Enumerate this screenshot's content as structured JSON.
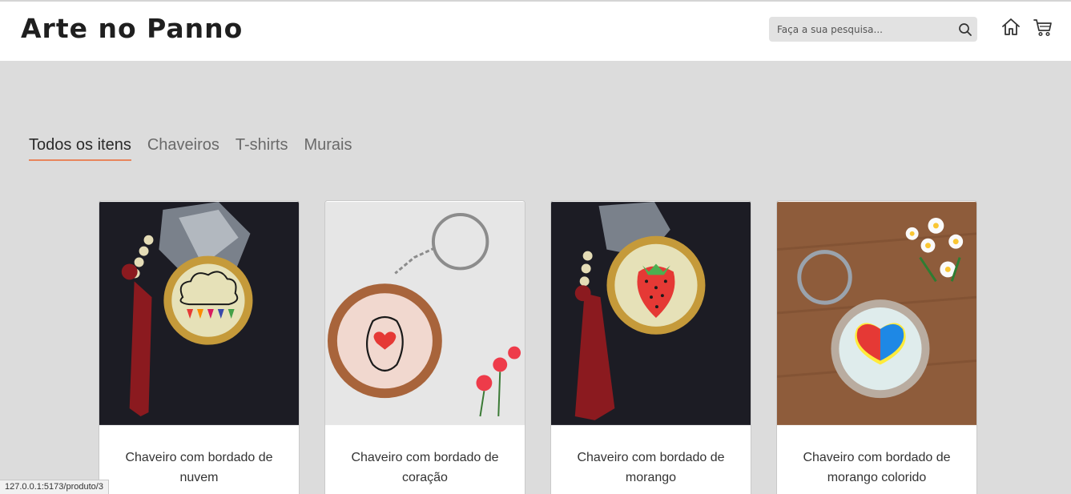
{
  "header": {
    "logo": "Arte no Panno",
    "search_placeholder": "Faça a sua pesquisa...",
    "icons": [
      "search-icon",
      "home-icon",
      "cart-icon"
    ]
  },
  "tabs": [
    {
      "label": "Todos os itens",
      "active": true
    },
    {
      "label": "Chaveiros",
      "active": false
    },
    {
      "label": "T-shirts",
      "active": false
    },
    {
      "label": "Murais",
      "active": false
    }
  ],
  "products": [
    {
      "title": "Chaveiro com bordado de nuvem"
    },
    {
      "title": "Chaveiro com bordado de coração"
    },
    {
      "title": "Chaveiro com bordado de morango"
    },
    {
      "title": "Chaveiro com bordado de morango colorido"
    }
  ],
  "status_url": "127.0.0.1:5173/produto/3",
  "colors": {
    "accent": "#e8855c",
    "background": "#dcdcdc"
  }
}
